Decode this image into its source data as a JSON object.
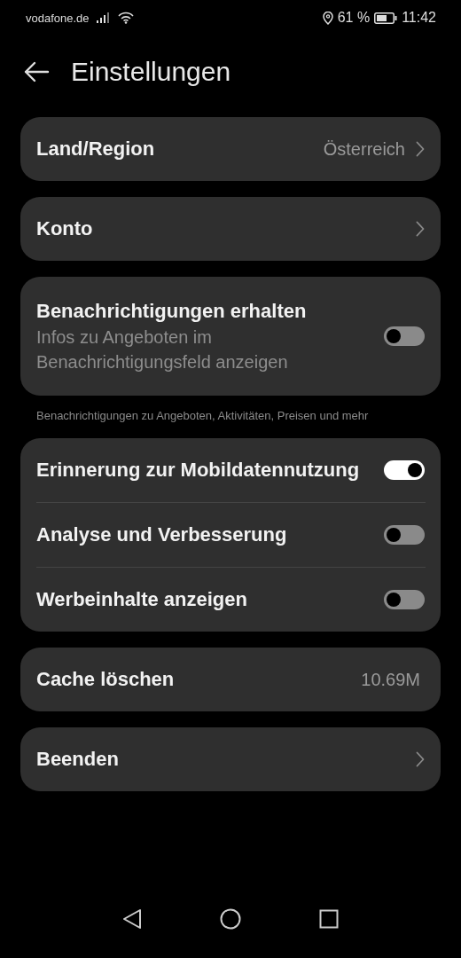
{
  "status_bar": {
    "carrier": "vodafone.de",
    "battery": "61 %",
    "time": "11:42"
  },
  "header": {
    "title": "Einstellungen"
  },
  "groups": [
    {
      "rows": [
        {
          "kind": "link",
          "title": "Land/Region",
          "value": "Österreich"
        }
      ]
    },
    {
      "rows": [
        {
          "kind": "link",
          "title": "Konto"
        }
      ]
    },
    {
      "rows": [
        {
          "kind": "toggle",
          "title": "Benachrichtigungen erhalten",
          "subtitle": "Infos zu Angeboten im Benachrichtigungsfeld anzeigen",
          "on": false
        }
      ],
      "note": "Benachrichtigungen zu Angeboten, Aktivitäten, Preisen und mehr"
    },
    {
      "rows": [
        {
          "kind": "toggle",
          "title": "Erinnerung zur Mobildatennutzung",
          "on": true
        },
        {
          "kind": "toggle",
          "title": "Analyse und Verbesserung",
          "on": false
        },
        {
          "kind": "toggle",
          "title": "Werbeinhalte anzeigen",
          "on": false
        }
      ]
    },
    {
      "rows": [
        {
          "kind": "info",
          "title": "Cache löschen",
          "value": "10.69M"
        }
      ]
    },
    {
      "rows": [
        {
          "kind": "link",
          "title": "Beenden"
        }
      ]
    }
  ]
}
